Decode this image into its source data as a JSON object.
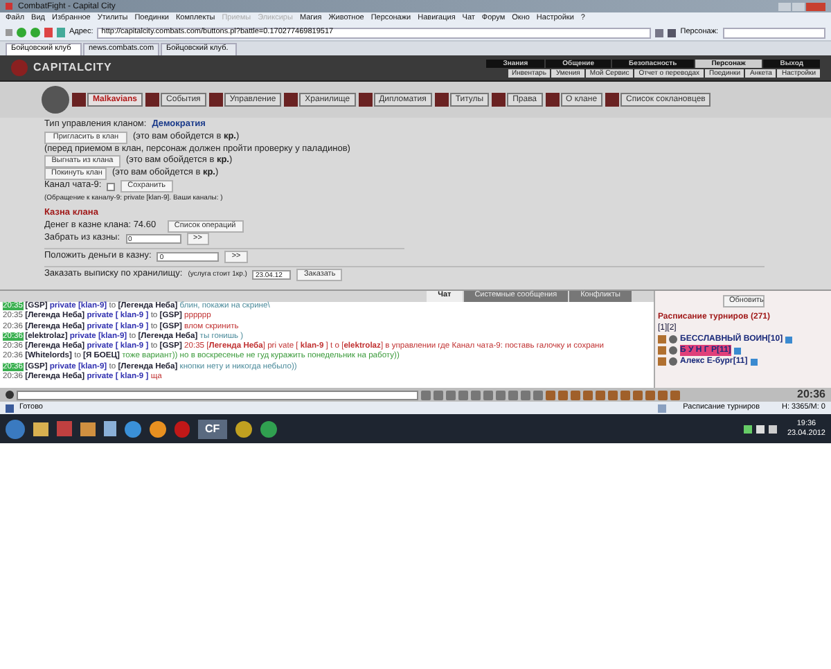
{
  "window": {
    "title": "CombatFight - Capital City"
  },
  "menu": [
    {
      "label": "Файл",
      "disabled": false
    },
    {
      "label": "Вид",
      "disabled": false
    },
    {
      "label": "Избранное",
      "disabled": false
    },
    {
      "label": "Утилиты",
      "disabled": false
    },
    {
      "label": "Поединки",
      "disabled": false
    },
    {
      "label": "Комплекты",
      "disabled": false
    },
    {
      "label": "Приемы",
      "disabled": true
    },
    {
      "label": "Эликсиры",
      "disabled": true
    },
    {
      "label": "Магия",
      "disabled": false
    },
    {
      "label": "Животное",
      "disabled": false
    },
    {
      "label": "Персонажи",
      "disabled": false
    },
    {
      "label": "Навигация",
      "disabled": false
    },
    {
      "label": "Чат",
      "disabled": false
    },
    {
      "label": "Форум",
      "disabled": false
    },
    {
      "label": "Окно",
      "disabled": false
    },
    {
      "label": "Настройки",
      "disabled": false
    },
    {
      "label": "?",
      "disabled": false
    }
  ],
  "address": {
    "label": "Адрес:",
    "url": "http://capitalcity.combats.com/buttons.pl?battle=0.170277469819517",
    "character_label": "Персонаж:"
  },
  "tabs": [
    {
      "label": "Бойцовский клуб",
      "selected": true
    },
    {
      "label": "news.combats.com",
      "selected": false
    },
    {
      "label": "Бойцовский клуб.",
      "selected": false
    }
  ],
  "game": {
    "logo": "CAPITALCITY",
    "nav": [
      {
        "label": "Знания",
        "selected": false
      },
      {
        "label": "Общение",
        "selected": false
      },
      {
        "label": "Безопасность",
        "selected": false
      },
      {
        "label": "Персонаж",
        "selected": true
      },
      {
        "label": "Выход",
        "selected": false
      }
    ],
    "subnav": [
      "Инвентарь",
      "Умения",
      "Мой Сервис",
      "Отчет о переводах",
      "Поединки",
      "Анкета",
      "Настройки"
    ]
  },
  "clan_menu": [
    {
      "label": "Malkavians",
      "selected": true
    },
    {
      "label": "События",
      "selected": false
    },
    {
      "label": "Управление",
      "selected": false
    },
    {
      "label": "Хранилище",
      "selected": false
    },
    {
      "label": "Дипломатия",
      "selected": false
    },
    {
      "label": "Титулы",
      "selected": false
    },
    {
      "label": "Права",
      "selected": false
    },
    {
      "label": "О клане",
      "selected": false
    },
    {
      "label": "Список соклановцев",
      "selected": false
    }
  ],
  "management": {
    "type_label": "Тип управления кланом:",
    "type_value": "Демократия",
    "invite_button": "Пригласить в клан",
    "invite_cost": "(это вам обойдется в **кр.**)",
    "invite_note": "(перед приемом в клан, персонаж должен пройти проверку у паладинов)",
    "kick_button": "Выгнать из клана",
    "kick_cost": "(это вам обойдется в **кр.**)",
    "leave_button": "Покинуть клан",
    "leave_cost": "(это вам обойдется в **кр.**)",
    "channel_label": "Канал чата-9:",
    "channel_checked": false,
    "save_button": "Сохранить",
    "channel_note": "(Обращение к каналу-9: private [klan-9]. Ваши каналы: )"
  },
  "treasury": {
    "title": "Казна клана",
    "balance": "Денег в казне клана: 74.60",
    "operations_button": "Список операций",
    "withdraw_label": "Забрать из казны:",
    "withdraw_value": "0",
    "withdraw_button": ">>",
    "deposit_label": "Положить деньги в казну:",
    "deposit_value": "0",
    "deposit_button": ">>",
    "statement_label": "Заказать выписку по хранилищу:",
    "statement_note": "(услуга стоит 1кр.)",
    "statement_date": "23.04.12",
    "statement_button": "Заказать"
  },
  "chat_tabs": [
    {
      "label": "Чат",
      "selected": true
    },
    {
      "label": "Системные сообщения",
      "selected": false
    },
    {
      "label": "Конфликты",
      "selected": false
    }
  ],
  "chat": [
    {
      "time": "20:35",
      "highlighted": true,
      "sender": "[GSP]",
      "channel": "private [klan-9]",
      "to": "to",
      "recipient": "[Легенда Неба]",
      "text": "блин, покажи на скрине\\",
      "color": "#4a8a9a"
    },
    {
      "time": "20:35",
      "highlighted": false,
      "sender": "[Легенда Неба]",
      "channel": "private [ klan-9 ]",
      "to": "to",
      "recipient": "[GSP]",
      "text": "pppppp",
      "color": "#c03030"
    },
    {
      "time": "20:36",
      "highlighted": false,
      "sender": "[Легенда Неба]",
      "channel": "private [ klan-9 ]",
      "to": "to",
      "recipient": "[GSP]",
      "text": "влом скринить",
      "color": "#c03030"
    },
    {
      "time": "20:36",
      "highlighted": true,
      "sender": "[elektrolaz]",
      "channel": "private [klan-9]",
      "to": "to",
      "recipient": "[Легенда Неба]",
      "text": "ты гонишь )",
      "color": "#4a8a9a"
    },
    {
      "time": "20:36",
      "highlighted": false,
      "sender": "[Легенда Неба]",
      "channel": "private [ klan-9 ]",
      "to": "to",
      "recipient": "[GSP]",
      "text": "20:35 [**Легенда Неба**] pri vate [ **klan-9** ] t o [**elektrolaz**] в управлении где Канал чата-9: поставь галочку и сохрани",
      "color": "#c03030"
    },
    {
      "time": "20:36",
      "highlighted": false,
      "sender": "[Whitelords]",
      "to": "to",
      "recipient": "[Я БОЕЦ]",
      "text": "тоже вариант)) но в воскресенье не гуд куражить понедельник на работу))",
      "color": "#3a9a3a"
    },
    {
      "time": "20:36",
      "highlighted": true,
      "sender": "[GSP]",
      "channel": "private [klan-9]",
      "to": "to",
      "recipient": "[Легенда Неба]",
      "text": "кнопки нету и никогда небыло))",
      "color": "#4a8a9a"
    },
    {
      "time": "20:36",
      "highlighted": false,
      "sender": "[Легенда Неба]",
      "channel": "private [ klan-9 ]",
      "text": "ща",
      "color": "#c03030"
    }
  ],
  "tournaments": {
    "refresh_button": "Обновить",
    "title": "Расписание турниров (271)",
    "pages": "[1][2]",
    "players": [
      {
        "name": "БЕССЛАВНЫЙ ВОИН",
        "level": "[10]",
        "highlighted": false
      },
      {
        "name": "Б У Н Г Р",
        "level": "[11]",
        "highlighted": true
      },
      {
        "name": "Алекс Е-бург",
        "level": "[11]",
        "highlighted": false
      }
    ]
  },
  "chat_clock": "20:36",
  "status_bar": {
    "text": "Готово",
    "panel": "Расписание турниров",
    "stats": "H: 3365/M: 0"
  },
  "taskbar": {
    "app_label": "CF",
    "time": "19:36",
    "date": "23.04.2012"
  }
}
